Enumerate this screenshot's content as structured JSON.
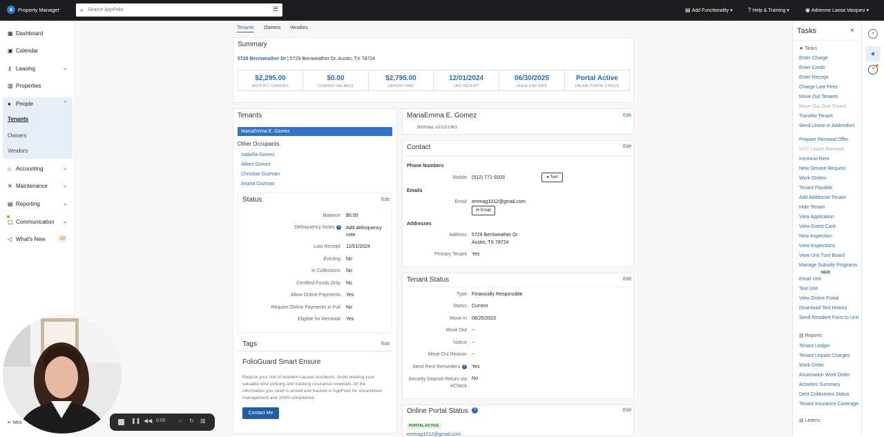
{
  "topbar": {
    "app_name": "Property Manager",
    "search_placeholder": "Search AppFolio",
    "add_functionality": "Add Functionality",
    "help_training": "Help & Training",
    "user_name": "Adrienne Laosa Vasquez"
  },
  "sidebar": {
    "items": [
      {
        "label": "Dashboard",
        "icon": "dashboard-icon"
      },
      {
        "label": "Calendar",
        "icon": "calendar-icon"
      },
      {
        "label": "Leasing",
        "icon": "key-icon"
      },
      {
        "label": "Properties",
        "icon": "building-icon"
      },
      {
        "label": "People",
        "icon": "person-icon"
      },
      {
        "label": "Accounting",
        "icon": "bank-icon"
      },
      {
        "label": "Maintenance",
        "icon": "wrench-icon"
      },
      {
        "label": "Reporting",
        "icon": "report-icon"
      },
      {
        "label": "Communication",
        "icon": "chat-icon"
      },
      {
        "label": "What's New",
        "icon": "megaphone-icon"
      }
    ],
    "people_sub": [
      "Tenants",
      "Owners",
      "Vendors"
    ],
    "whats_new_count": "22",
    "minimize": "Mini"
  },
  "tabs": [
    "Tenants",
    "Owners",
    "Vendors"
  ],
  "summary": {
    "title": "Summary",
    "property_link": "5729 Berriweather Dr",
    "address": "| 5729 Berriweather Dr, Austin, TX 78724",
    "stats": [
      {
        "value": "$2,295.00",
        "label": "MONTHLY CHARGES"
      },
      {
        "value": "$0.00",
        "label": "CURRENT BALANCE"
      },
      {
        "value": "$2,795.00",
        "label": "DEPOSIT PAID"
      },
      {
        "value": "12/01/2024",
        "label": "LAST RECEIPT"
      },
      {
        "value": "06/30/2025",
        "label": "LEASE END DATE"
      },
      {
        "value": "Portal Active",
        "label": "ONLINE PORTAL STATUS"
      }
    ]
  },
  "tenants_card": {
    "title": "Tenants",
    "selected": "MariaEmma E. Gomez",
    "other_occupants_title": "Other Occupants",
    "occupants": [
      "Isabella Gomez",
      "Albert Gomez",
      "Christian Guzman",
      "Ariana Guzman"
    ]
  },
  "status_card": {
    "title": "Status",
    "edit": "Edit",
    "rows": [
      {
        "label": "Balance",
        "value": "$0.00"
      },
      {
        "label": "Delinquency Notes",
        "value": "Add delinquency note"
      },
      {
        "label": "Last Receipt",
        "value": "12/01/2024"
      },
      {
        "label": "Evicting",
        "value": "No"
      },
      {
        "label": "In Collections",
        "value": "No"
      },
      {
        "label": "Certified Funds Only",
        "value": "No"
      },
      {
        "label": "Allow Online Payments",
        "value": "Yes"
      },
      {
        "label": "Require Online Payments in Full",
        "value": "No"
      },
      {
        "label": "Eligible for Renewal",
        "value": "Yes"
      }
    ]
  },
  "tags_card": {
    "title": "Tags",
    "edit": "Edit"
  },
  "folioguard": {
    "title": "FolioGuard Smart Ensure",
    "text": "Reduce your risk of resident-caused accidents. Avoid wasting your valuable time policing and tracking insurance renewals. All the information you need is stored and tracked in AppFolio for streamlined management and 100% compliance.",
    "button": "Contact Me"
  },
  "tenant_header": {
    "name": "MariaEmma E. Gomez",
    "birthday": "Birthday 10/12/1961",
    "edit": "Edit"
  },
  "contact": {
    "title": "Contact",
    "edit": "Edit",
    "phone_title": "Phone Numbers",
    "phone_label": "Mobile",
    "phone": "(512) 771-9203",
    "text_button": "Text",
    "emails_title": "Emails",
    "email_label": "Email",
    "email": "emmag1012@gmail.com",
    "email_button": "Email",
    "addresses_title": "Addresses",
    "address_label": "Address",
    "address_line1": "5729 Berriweather Dr",
    "address_line2": "Austin, TX 78724",
    "primary_label": "Primary Tenant",
    "primary_value": "Yes"
  },
  "tenant_status": {
    "title": "Tenant Status",
    "edit": "Edit",
    "rows": [
      {
        "label": "Type",
        "value": "Financially Responsible"
      },
      {
        "label": "Status",
        "value": "Current"
      },
      {
        "label": "Move In",
        "value": "08/25/2023"
      },
      {
        "label": "Move Out",
        "value": "--"
      },
      {
        "label": "Notice",
        "value": "--"
      },
      {
        "label": "Move Out Reason",
        "value": "--"
      },
      {
        "label": "Send Rent Reminders",
        "value": "Yes"
      },
      {
        "label": "Security Deposit Return via eCheck",
        "value": "No"
      }
    ]
  },
  "online_portal": {
    "title": "Online Portal Status",
    "edit": "Edit",
    "badge": "PORTAL ACTIVE",
    "email": "emmag1012@gmail.com"
  },
  "tasks_panel": {
    "title": "Tasks",
    "tasks_heading": "Tasks",
    "tasks": [
      "Enter Charge",
      "Enter Credit",
      "Enter Receipt",
      "Charge Late Fees",
      "Move Out Tenants",
      "Move Out One Tenant",
      "Transfer Tenant",
      "Send Lease or Addendum",
      "Prepare Renewal Offer",
      "NYC Lease Renewal",
      "Increase Rent",
      "New Service Request",
      "Work Orders",
      "Tenant Payable",
      "Add Additional Tenant",
      "Hide Tenant",
      "View Application",
      "View Guest Card",
      "New Inspection",
      "View Inspections",
      "View Unit Turn Board",
      "Manage Subsidy Programs",
      "Email Unit",
      "Text Unit",
      "View Online Portal",
      "Download Text History",
      "Send Resident Form to Unit"
    ],
    "new_badge": "NEW",
    "reports_heading": "Reports",
    "reports": [
      "Tenant Ledger",
      "Tenant Unpaid Charges",
      "Work Order",
      "Association Work Order",
      "Activities Summary",
      "Debt Collections Status",
      "Tenant Insurance Coverage"
    ],
    "letters_heading": "Letters"
  },
  "player": {
    "time": "0:00"
  }
}
